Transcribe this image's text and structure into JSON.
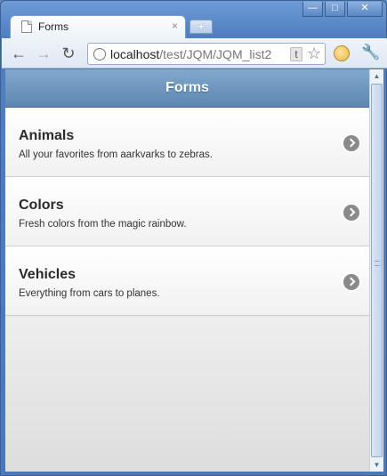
{
  "browser": {
    "tab": {
      "title": "Forms",
      "close_glyph": "×"
    },
    "new_tab_glyph": "+",
    "window_controls": {
      "minimize": "—",
      "maximize": "□",
      "close": "✕"
    },
    "nav": {
      "back": "←",
      "forward": "→",
      "reload": "↻"
    },
    "address": {
      "host": "localhost",
      "path": "/test/JQM/JQM_list2",
      "badge": "t"
    },
    "star_glyph": "☆",
    "wrench_glyph": "🔧"
  },
  "page": {
    "header_title": "Forms",
    "items": [
      {
        "title": "Animals",
        "description": "All your favorites from aarkvarks to zebras."
      },
      {
        "title": "Colors",
        "description": "Fresh colors from the magic rainbow."
      },
      {
        "title": "Vehicles",
        "description": "Everything from cars to planes."
      }
    ]
  },
  "icons": {
    "tab_favicon": "page-icon",
    "address_icon": "globe-icon",
    "bookmark": "star-icon",
    "extension": "face-icon",
    "menu": "wrench-icon",
    "item_arrow": "chevron-right-icon"
  },
  "colors": {
    "header_gradient_top": "#81a8ce",
    "header_gradient_bottom": "#5e87b0",
    "chevron": "#8a8a8a",
    "frame": "#4f7fc0"
  }
}
